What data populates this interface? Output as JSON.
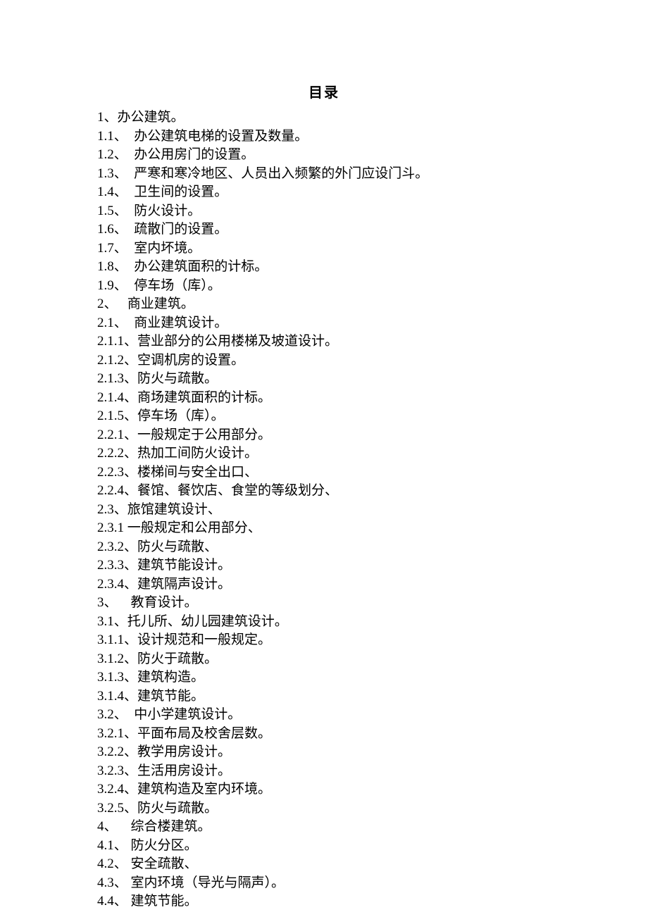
{
  "title": "目录",
  "entries": [
    "1、办公建筑。",
    "1.1、  办公建筑电梯的设置及数量。",
    "1.2、  办公用房门的设置。",
    "1.3、  严寒和寒冷地区、人员出入频繁的外门应设门斗。",
    "1.4、  卫生间的设置。",
    "1.5、  防火设计。",
    "1.6、  疏散门的设置。",
    "1.7、  室内坏境。",
    "1.8、  办公建筑面积的计标。",
    "1.9、  停车场（库）。",
    "2、   商业建筑。",
    "2.1、  商业建筑设计。",
    "2.1.1、营业部分的公用楼梯及坡道设计。",
    "2.1.2、空调机房的设置。",
    "2.1.3、防火与疏散。",
    "2.1.4、商场建筑面积的计标。",
    "2.1.5、停车场（库）。",
    "2.2.1、一般规定于公用部分。",
    "2.2.2、热加工间防火设计。",
    "2.2.3、楼梯间与安全出口、",
    "2.2.4、餐馆、餐饮店、食堂的等级划分、",
    "2.3、旅馆建筑设计、",
    "2.3.1 一般规定和公用部分、",
    "2.3.2、防火与疏散、",
    "2.3.3、建筑节能设计。",
    "2.3.4、建筑隔声设计。",
    "3、    教育设计。",
    "3.1、托儿所、幼儿园建筑设计。",
    "3.1.1、设计规范和一般规定。",
    "3.1.2、防火于疏散。",
    "3.1.3、建筑构造。",
    "3.1.4、建筑节能。",
    "3.2、  中小学建筑设计。",
    "3.2.1、平面布局及校舍层数。",
    "3.2.2、教学用房设计。",
    "3.2.3、生活用房设计。",
    "3.2.4、建筑构造及室内环境。",
    "3.2.5、防火与疏散。",
    "4、    综合楼建筑。",
    "4.1、 防火分区。",
    "4.2、 安全疏散、",
    "4.3、 室内环境（导光与隔声）。",
    "4.4、 建筑节能。"
  ]
}
